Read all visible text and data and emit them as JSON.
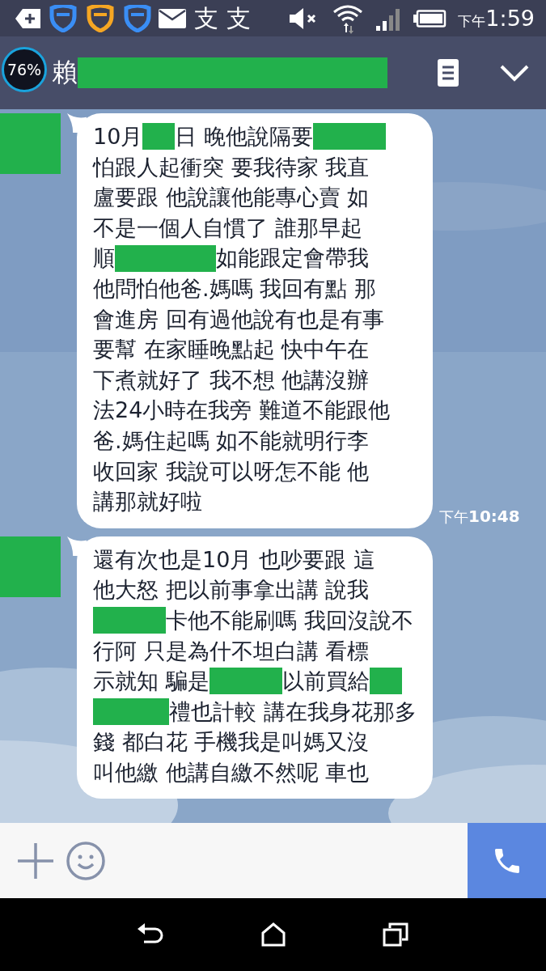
{
  "status_bar": {
    "notification_glyphs": [
      "支",
      "支"
    ],
    "time_prefix": "下午",
    "time": "1:59"
  },
  "header": {
    "battery_widget": "76%",
    "title": "賴",
    "title_redacted": true
  },
  "messages": [
    {
      "avatar_redacted": true,
      "time_prefix": "下午",
      "time": "10:48",
      "lines": [
        [
          {
            "kind": "text",
            "text": "10月"
          },
          {
            "kind": "blot"
          },
          {
            "kind": "text",
            "text": "日 晚他說隔要"
          },
          {
            "kind": "block"
          }
        ],
        [
          {
            "kind": "text",
            "text": "怕跟人起衝突 要我待家 我直"
          }
        ],
        [
          {
            "kind": "text",
            "text": "盧要跟 他說讓他能專心賣 如"
          }
        ],
        [
          {
            "kind": "text",
            "text": "不是一個人自慣了 誰那早起"
          }
        ],
        [
          {
            "kind": "text",
            "text": "順"
          },
          {
            "kind": "band"
          },
          {
            "kind": "text",
            "text": " 如能跟定會帶我"
          }
        ],
        [
          {
            "kind": "text",
            "text": "他問怕他爸.媽嗎 我回有點 那"
          }
        ],
        [
          {
            "kind": "text",
            "text": "會進房 回有過他說有也是有事"
          }
        ],
        [
          {
            "kind": "text",
            "text": "要幫 在家睡晚點起 快中午在"
          }
        ],
        [
          {
            "kind": "text",
            "text": "下煮就好了 我不想 他講沒辦"
          }
        ],
        [
          {
            "kind": "text",
            "text": "法24小時在我旁 難道不能跟他"
          }
        ],
        [
          {
            "kind": "text",
            "text": "爸.媽住起嗎 如不能就明行李"
          }
        ],
        [
          {
            "kind": "text",
            "text": "收回家 我說可以呀怎不能 他"
          }
        ],
        [
          {
            "kind": "text",
            "text": "講那就好啦"
          }
        ]
      ]
    },
    {
      "avatar_redacted": true,
      "lines": [
        [
          {
            "kind": "text",
            "text": "還有次也是10月 也吵要跟 這"
          }
        ],
        [
          {
            "kind": "text",
            "text": "他大怒 把以前事拿出講 說我"
          }
        ],
        [
          {
            "kind": "block"
          },
          {
            "kind": "text",
            "text": "卡他不能刷嗎 我回沒說不"
          }
        ],
        [
          {
            "kind": "text",
            "text": "行阿 只是為什不坦白講 看標"
          }
        ],
        [
          {
            "kind": "text",
            "text": "示就知 騙是"
          },
          {
            "kind": "block"
          },
          {
            "kind": "text",
            "text": " 以前買給"
          },
          {
            "kind": "blot"
          }
        ],
        [
          {
            "kind": "band"
          },
          {
            "kind": "text",
            "text": "禮也計較 講在我身花那多"
          }
        ],
        [
          {
            "kind": "text",
            "text": "錢 都白花 手機我是叫媽又沒"
          }
        ],
        [
          {
            "kind": "text",
            "text": "叫他繳 他講自繳不然呢 車也"
          }
        ]
      ]
    }
  ]
}
